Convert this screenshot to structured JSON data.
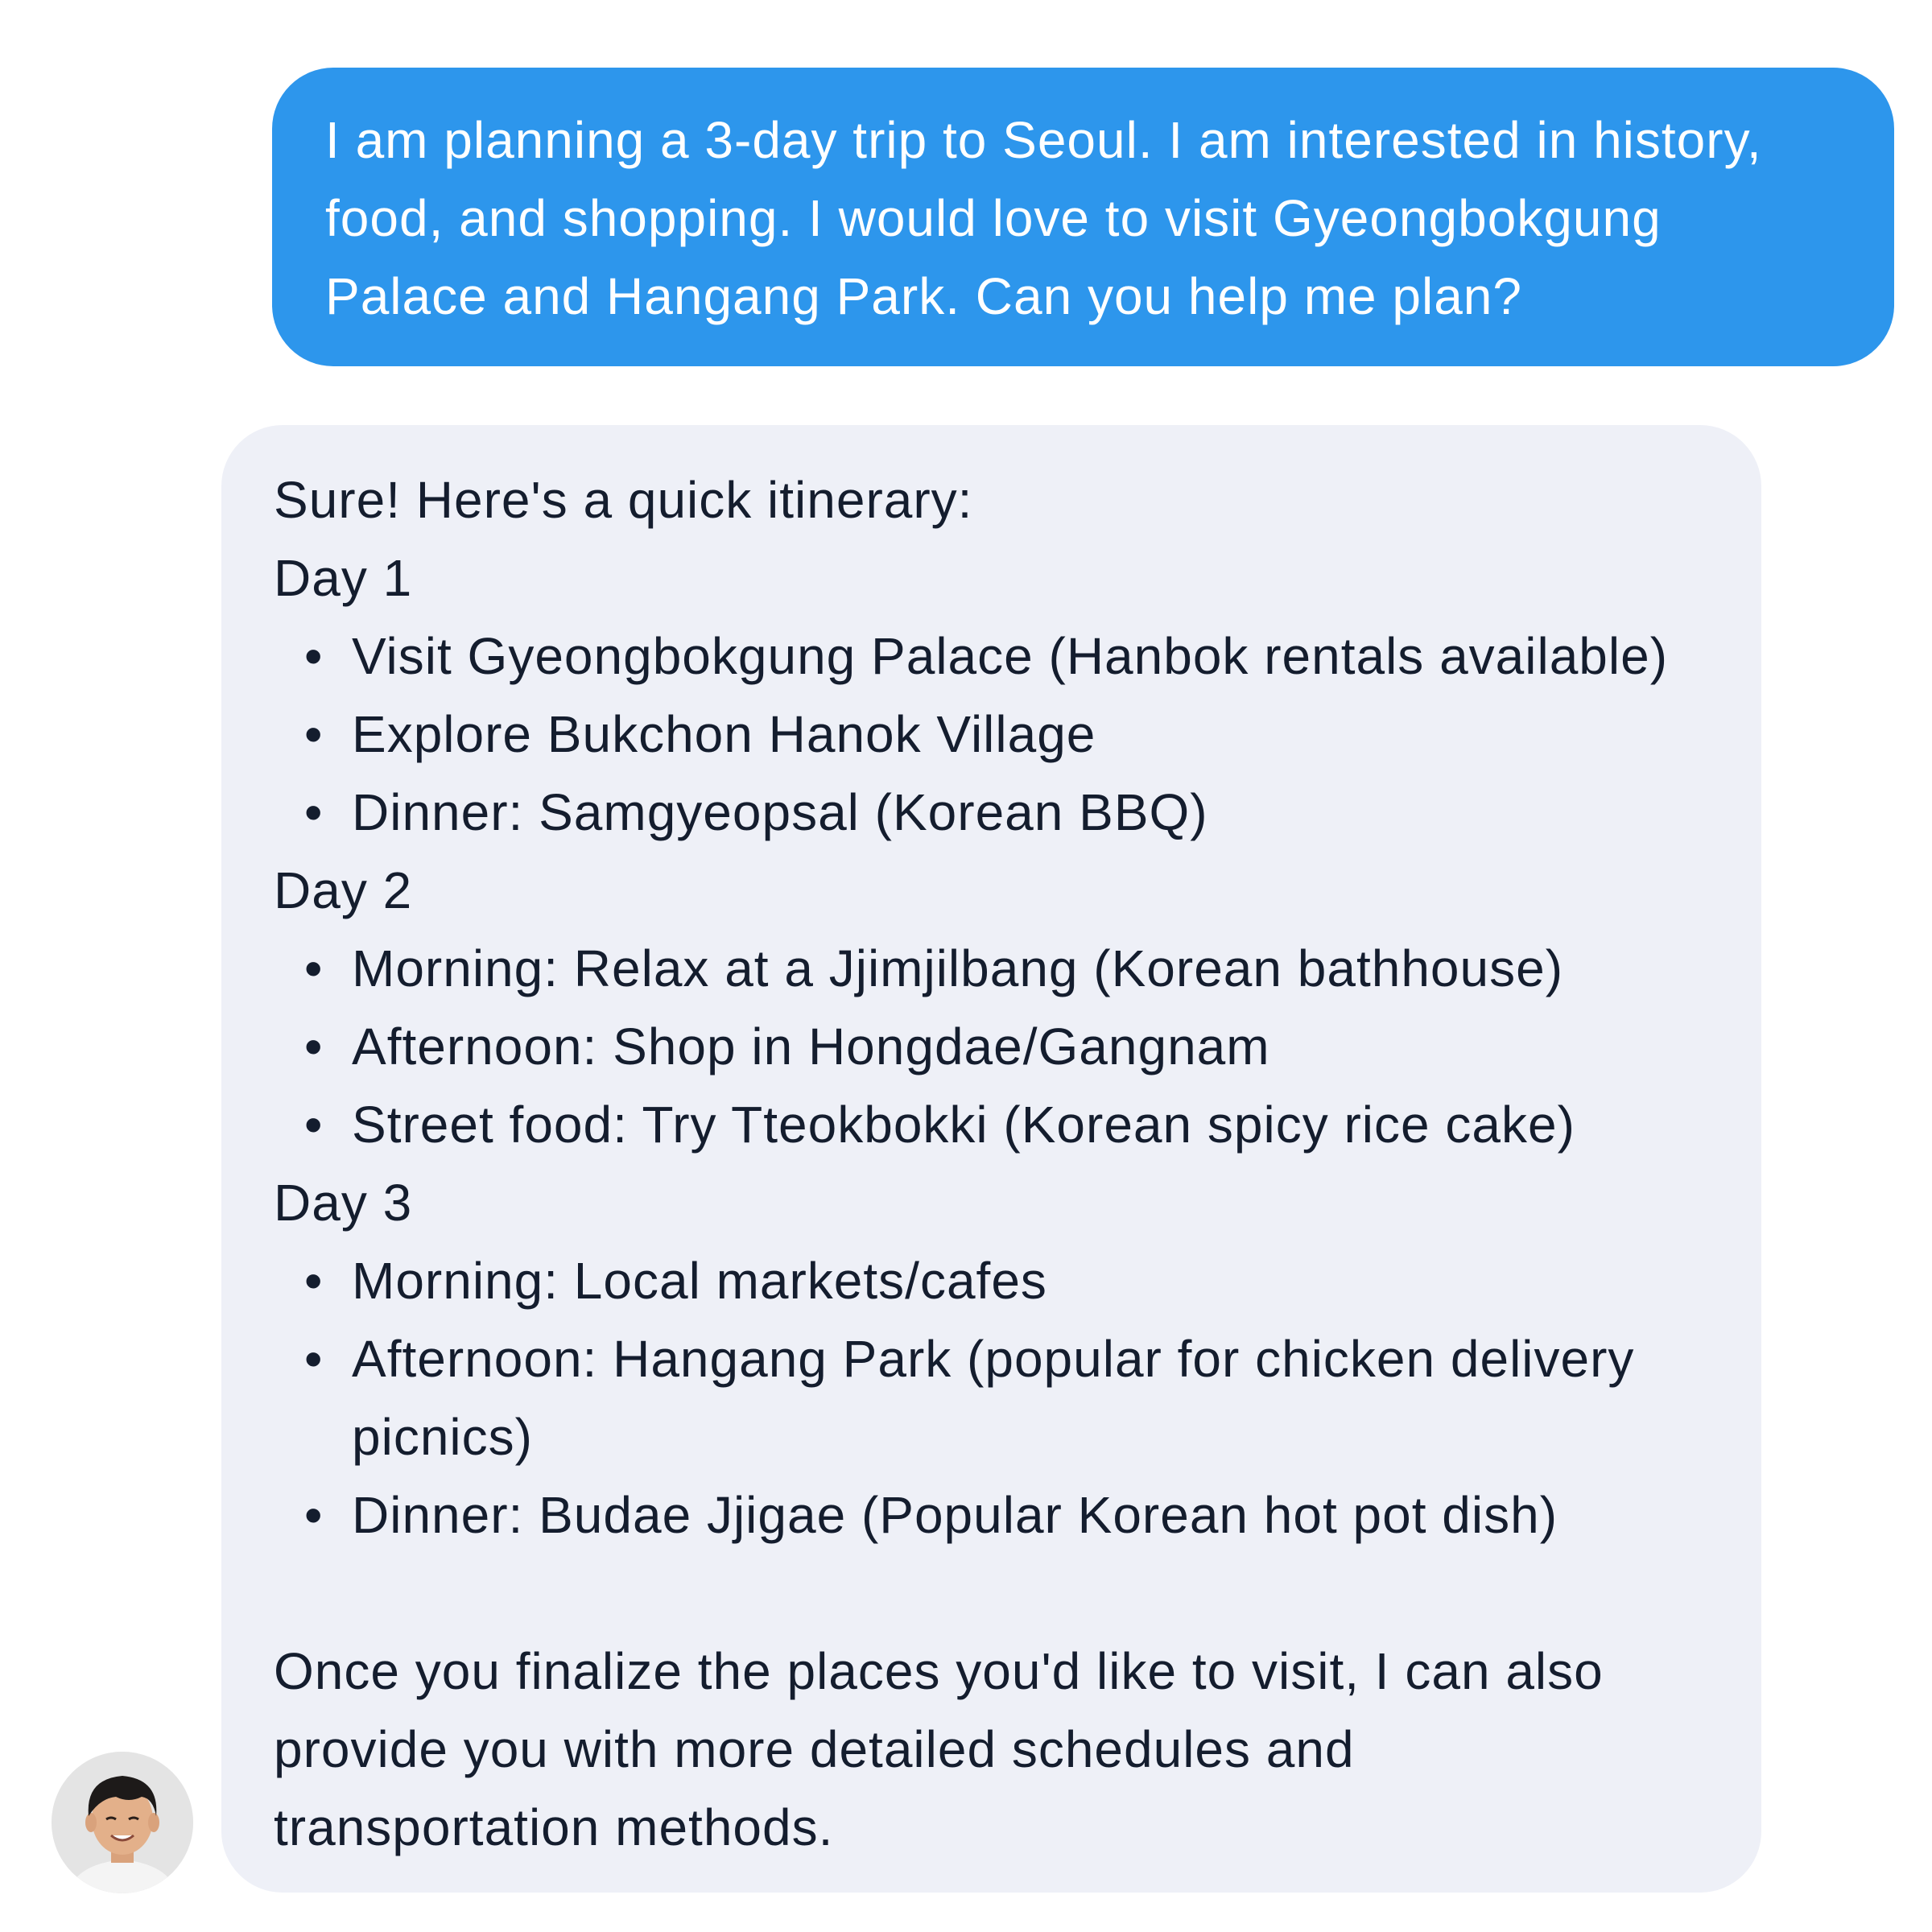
{
  "user_message": {
    "lines": [
      " I am planning a 3-day trip to Seoul. I am interested in history,",
      "food, and shopping. I would love to visit Gyeongbokgung",
      "Palace and Hangang Park. Can you help me plan?"
    ]
  },
  "assistant_message": {
    "intro": "Sure! Here's a quick itinerary:",
    "days": [
      {
        "title": "Day 1",
        "items": [
          "Visit Gyeongbokgung Palace (Hanbok rentals available)",
          "Explore Bukchon Hanok Village",
          "Dinner: Samgyeopsal (Korean BBQ)"
        ]
      },
      {
        "title": "Day 2",
        "items": [
          "Morning: Relax at a Jjimjilbang (Korean bathhouse)",
          "Afternoon: Shop in Hongdae/Gangnam",
          "Street food: Try Tteokbokki (Korean spicy rice cake)"
        ]
      },
      {
        "title": "Day 3",
        "items": [
          "Morning: Local markets/cafes",
          "Afternoon: Hangang Park (popular for chicken delivery picnics)",
          "Dinner: Budae Jjigae (Popular Korean hot pot dish)"
        ]
      }
    ],
    "closing_lines": [
      "Once you finalize the places you'd like to visit, I can also",
      "provide you with more detailed schedules and",
      "transportation methods."
    ]
  },
  "bullet_glyph": "•",
  "colors": {
    "user_bubble": "#2d96ec",
    "assistant_bubble": "#eef0f7",
    "assistant_text": "#141d2e",
    "user_text": "#ffffff"
  },
  "icons": {
    "avatar": "user-avatar-photo"
  }
}
